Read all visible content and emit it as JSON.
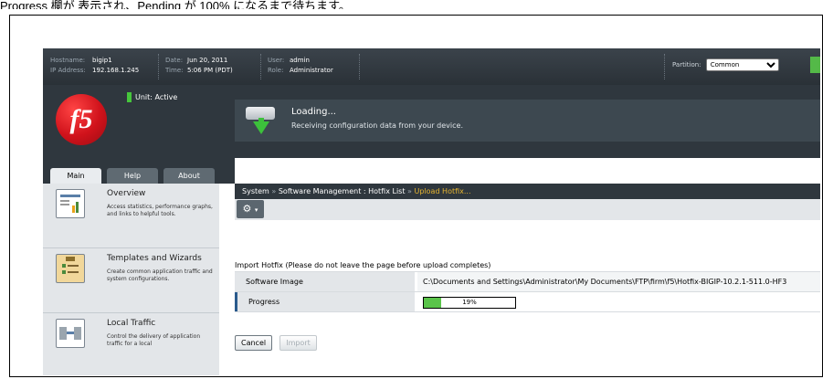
{
  "caption": "Progress 欄が 表示され、Pending が 100% になるまで待ちます。",
  "infobar": {
    "hostname_label": "Hostname:",
    "hostname": "bigip1",
    "ip_label": "IP Address:",
    "ip": "192.168.1.245",
    "date_label": "Date:",
    "date": "Jun 20, 2011",
    "time_label": "Time:",
    "time": "5:06 PM (PDT)",
    "user_label": "User:",
    "user": "admin",
    "role_label": "Role:",
    "role": "Administrator",
    "partition_label": "Partition:",
    "partition_value": "Common"
  },
  "header": {
    "logo_text": "f5",
    "unit_status": "Unit: Active",
    "loading_title": "Loading...",
    "loading_message": "Receiving configuration data from your device."
  },
  "tabs": [
    {
      "label": "Main"
    },
    {
      "label": "Help"
    },
    {
      "label": "About"
    }
  ],
  "sidebar": [
    {
      "title": "Overview",
      "desc": "Access statistics, performance graphs, and links to helpful tools."
    },
    {
      "title": "Templates and Wizards",
      "desc": "Create common application traffic and system configurations."
    },
    {
      "title": "Local Traffic",
      "desc": "Control the delivery of application traffic for a local"
    }
  ],
  "breadcrumb": {
    "system": "System",
    "sep1": "»",
    "section": "Software Management : Hotfix List",
    "sep2": "»",
    "current": "Upload Hotfix..."
  },
  "toolbar": {
    "gear_icon": "gear-icon"
  },
  "import": {
    "title": "Import Hotfix (Please do not leave the page before upload completes)",
    "rows": [
      {
        "label": "Software Image",
        "value": "C:\\Documents and Settings\\Administrator\\My Documents\\FTP\\firm\\f5\\Hotfix-BIGIP-10.2.1-511.0-HF3"
      },
      {
        "label": "Progress",
        "progress_text": "19%",
        "progress": 0.19
      }
    ]
  },
  "buttons": {
    "cancel": "Cancel",
    "import": "Import"
  },
  "colors": {
    "brand_red": "#d0121b",
    "active_green": "#46c63c",
    "crumb_current": "#e8b630",
    "progress_green": "#5ac44a"
  }
}
